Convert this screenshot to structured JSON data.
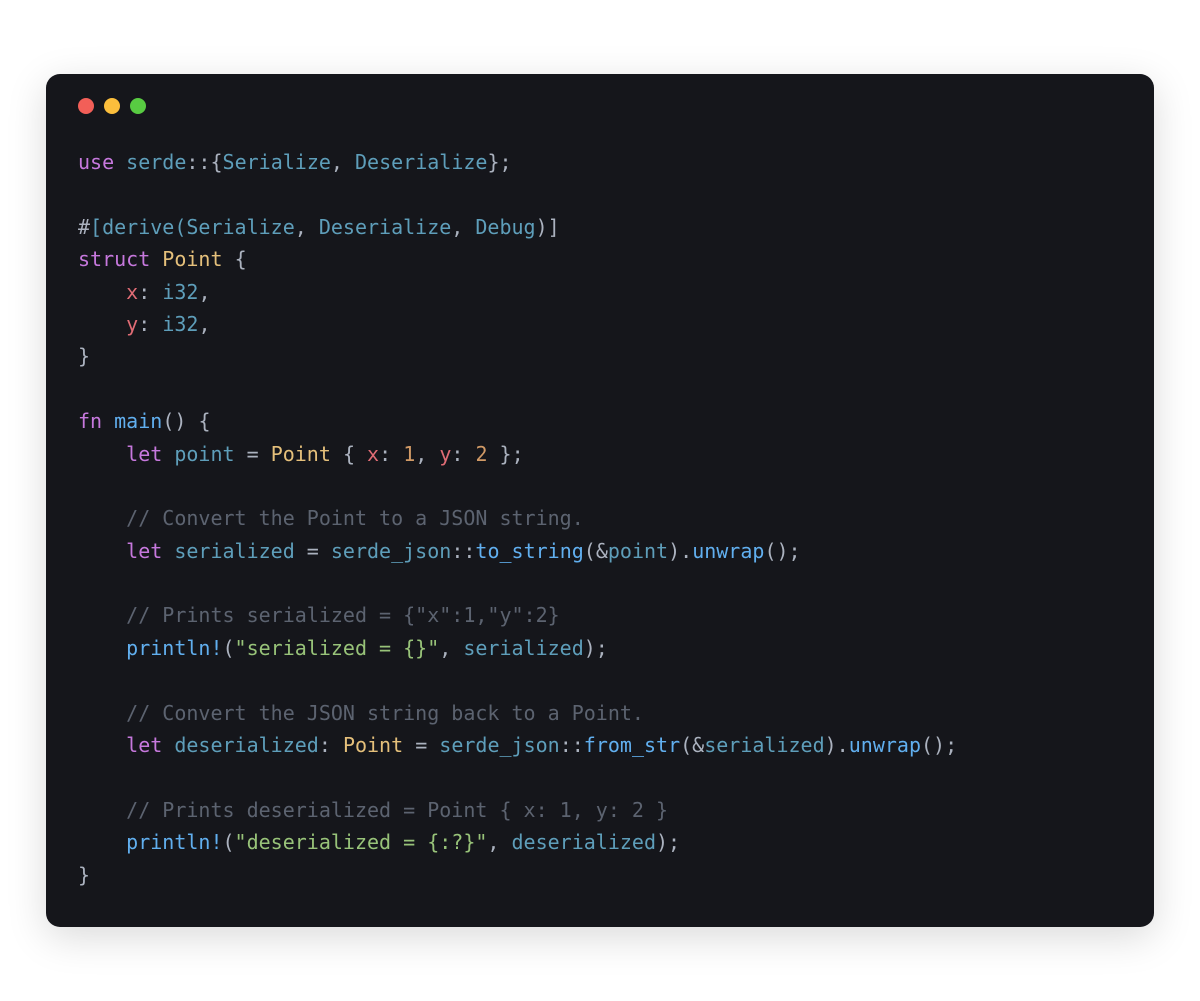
{
  "code": {
    "line1": {
      "use": "use",
      "serde": "serde",
      "colons": "::",
      "lbrace": "{",
      "Serialize": "Serialize",
      "comma": ", ",
      "Deserialize": "Deserialize",
      "rbrace": "}",
      "semi": ";"
    },
    "line3": {
      "hash": "#",
      "derive_open": "[derive(",
      "Serialize": "Serialize",
      "c1": ", ",
      "Deserialize": "Deserialize",
      "c2": ", ",
      "Debug": "Debug",
      "close": ")]"
    },
    "line4": {
      "struct": "struct",
      "sp": " ",
      "Point": "Point",
      "sp2": " ",
      "lbrace": "{"
    },
    "line5": {
      "indent": "    ",
      "x": "x",
      "colon": ": ",
      "i32": "i32",
      "c": ","
    },
    "line6": {
      "indent": "    ",
      "y": "y",
      "colon": ": ",
      "i32": "i32",
      "c": ","
    },
    "line7": {
      "rbrace": "}"
    },
    "line9": {
      "fn": "fn",
      "sp": " ",
      "main": "main",
      "paren": "() ",
      "lbrace": "{"
    },
    "line10": {
      "indent": "    ",
      "let": "let",
      "sp": " ",
      "point": "point",
      "eq": " = ",
      "Point": "Point",
      "sp2": " ",
      "lbrace": "{ ",
      "x": "x",
      "c1": ": ",
      "one": "1",
      "cm": ", ",
      "y": "y",
      "c2": ": ",
      "two": "2",
      "rbrace": " }",
      "semi": ";"
    },
    "line12": {
      "indent": "    ",
      "cmt": "// Convert the Point to a JSON string."
    },
    "line13": {
      "indent": "    ",
      "let": "let",
      "sp": " ",
      "serialized": "serialized",
      "eq": " = ",
      "serde_json": "serde_json",
      "cc": "::",
      "to_string": "to_string",
      "op": "(",
      "amp": "&",
      "point": "point",
      "cp": ").",
      "unwrap": "unwrap",
      "end": "();"
    },
    "line15": {
      "indent": "    ",
      "cmt": "// Prints serialized = {\"x\":1,\"y\":2}"
    },
    "line16": {
      "indent": "    ",
      "println": "println!",
      "op": "(",
      "str": "\"serialized = {}\"",
      "c": ", ",
      "serialized": "serialized",
      "cp": ");"
    },
    "line18": {
      "indent": "    ",
      "cmt": "// Convert the JSON string back to a Point."
    },
    "line19": {
      "indent": "    ",
      "let": "let",
      "sp": " ",
      "deserialized": "deserialized",
      "colon": ": ",
      "Point": "Point",
      "eq": " = ",
      "serde_json": "serde_json",
      "cc": "::",
      "from_str": "from_str",
      "op": "(",
      "amp": "&",
      "serialized": "serialized",
      "cp": ").",
      "unwrap": "unwrap",
      "end": "();"
    },
    "line21": {
      "indent": "    ",
      "cmt": "// Prints deserialized = Point { x: 1, y: 2 }"
    },
    "line22": {
      "indent": "    ",
      "println": "println!",
      "op": "(",
      "str": "\"deserialized = {:?}\"",
      "c": ", ",
      "deserialized": "deserialized",
      "cp": ");"
    },
    "line23": {
      "rbrace": "}"
    }
  }
}
